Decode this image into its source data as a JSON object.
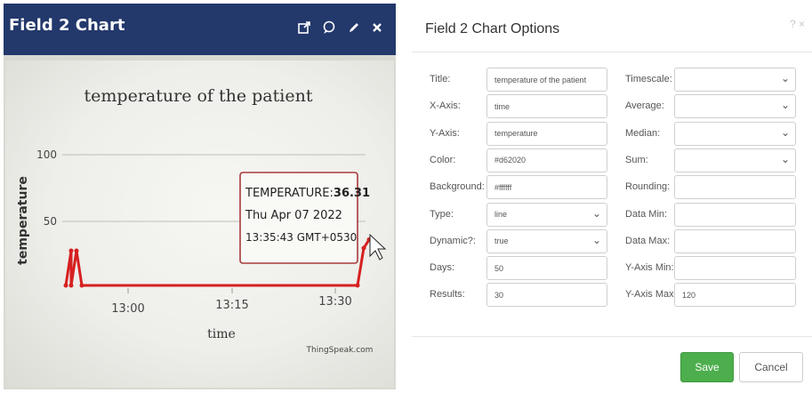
{
  "widget": {
    "title": "Field 2 Chart",
    "icons": [
      "external-link-icon",
      "comment-icon",
      "pencil-icon",
      "close-icon"
    ]
  },
  "chart_data": {
    "type": "line",
    "title": "temperature of the patient",
    "xlabel": "time",
    "ylabel": "temperature",
    "x_ticks": [
      "13:00",
      "13:15",
      "13:30"
    ],
    "y_ticks": [
      "100",
      "50"
    ],
    "ylim": [
      0,
      120
    ],
    "line_color": "#d62020",
    "series": [
      {
        "x": [
          "12:52",
          "12:53",
          "12:53",
          "12:54",
          "12:55",
          "13:33",
          "13:34",
          "13:35"
        ],
        "values": [
          2,
          28,
          2,
          28,
          2,
          2,
          30,
          36.31
        ]
      }
    ],
    "tooltip": {
      "series": "TEMPERATURE:",
      "value": "36.31",
      "date": "Thu Apr 07 2022",
      "time": "13:35:43 GMT+0530"
    },
    "credit": "ThingSpeak.com"
  },
  "dialog": {
    "title": "Field 2 Chart Options",
    "close": "? ×",
    "left_fields": [
      {
        "label": "Title:",
        "value": "temperature of the patient",
        "kind": "text"
      },
      {
        "label": "X-Axis:",
        "value": "time",
        "kind": "text"
      },
      {
        "label": "Y-Axis:",
        "value": "temperature",
        "kind": "text"
      },
      {
        "label": "Color:",
        "value": "#d62020",
        "kind": "text"
      },
      {
        "label": "Background:",
        "value": "#ffffff",
        "kind": "text"
      },
      {
        "label": "Type:",
        "value": "line",
        "kind": "select"
      },
      {
        "label": "Dynamic?:",
        "value": "true",
        "kind": "select"
      },
      {
        "label": "Days:",
        "value": "50",
        "kind": "text"
      },
      {
        "label": "Results:",
        "value": "30",
        "kind": "text"
      }
    ],
    "right_fields": [
      {
        "label": "Timescale:",
        "value": "",
        "kind": "select"
      },
      {
        "label": "Average:",
        "value": "",
        "kind": "select"
      },
      {
        "label": "Median:",
        "value": "",
        "kind": "select"
      },
      {
        "label": "Sum:",
        "value": "",
        "kind": "select"
      },
      {
        "label": "Rounding:",
        "value": "",
        "kind": "text"
      },
      {
        "label": "Data Min:",
        "value": "",
        "kind": "text"
      },
      {
        "label": "Data Max:",
        "value": "",
        "kind": "text"
      },
      {
        "label": "Y-Axis Min:",
        "value": "",
        "kind": "text"
      },
      {
        "label": "Y-Axis Max:",
        "value": "120",
        "kind": "text"
      }
    ],
    "save_label": "Save",
    "cancel_label": "Cancel",
    "save_color": "#4cae4c"
  }
}
